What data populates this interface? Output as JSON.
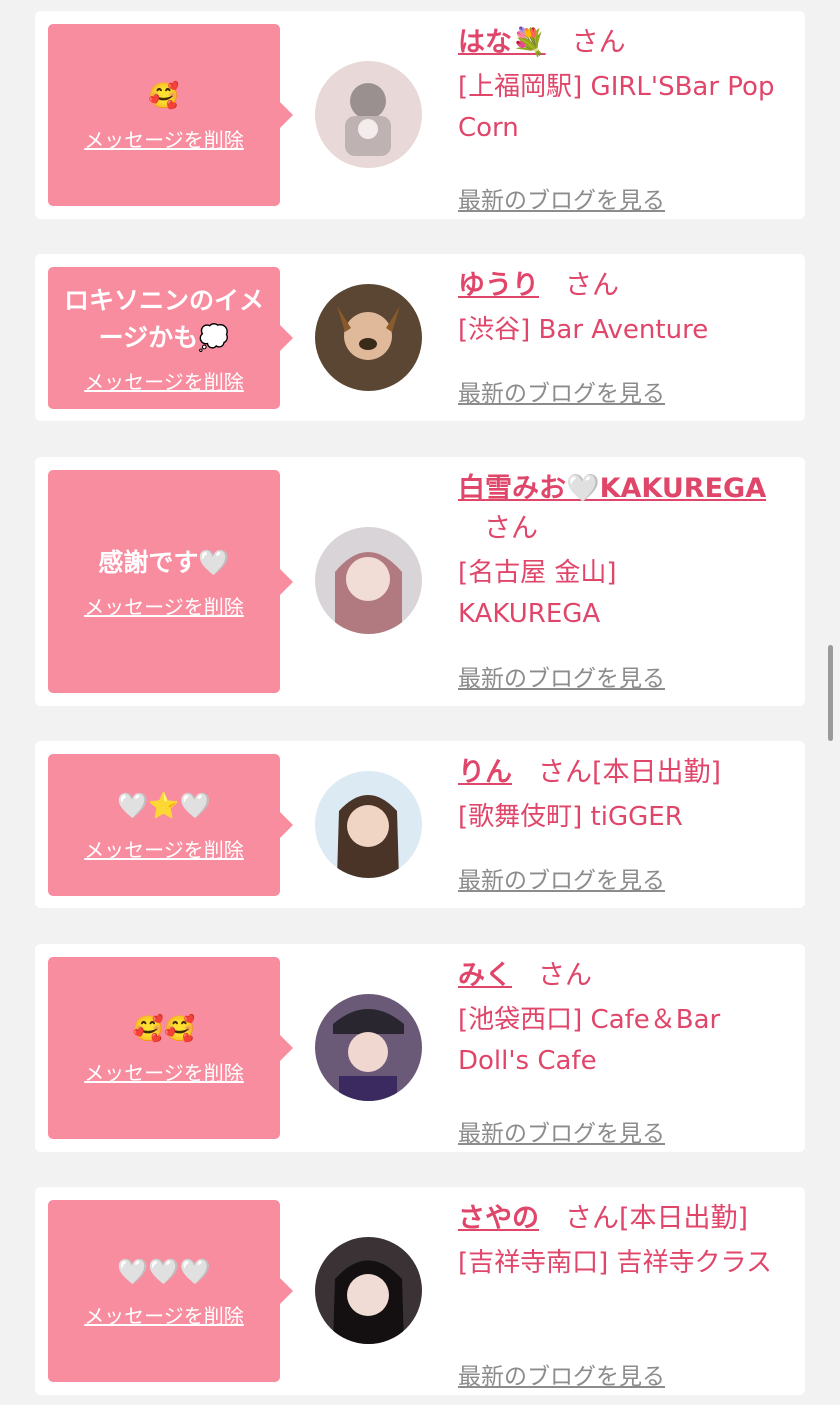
{
  "delete_label": "メッセージを削除",
  "blog_label": "最新のブログを見る",
  "san_label": "さん",
  "cards": [
    {
      "message": "🥰",
      "name": "はな💐",
      "san_suffix": "さん",
      "shop": "[上福岡駅] GIRL'SBar Pop Corn"
    },
    {
      "message": "ロキソニンのイメージかも💭",
      "name": "ゆうり",
      "san_suffix": "さん",
      "shop": "[渋谷] Bar Aventure"
    },
    {
      "message": "感謝です🤍",
      "name": "白雪みお🤍KAKUREGA",
      "san_suffix": "さん",
      "shop": "[名古屋 金山] KAKUREGA"
    },
    {
      "message": "🤍⭐🤍",
      "name": "りん",
      "san_suffix": "さん[本日出勤]",
      "shop": "[歌舞伎町] tiGGER"
    },
    {
      "message": "🥰🥰",
      "name": "みく",
      "san_suffix": "さん",
      "shop": "[池袋西口] Cafe＆Bar Doll's Cafe"
    },
    {
      "message": "🤍🤍🤍",
      "name": "さやの",
      "san_suffix": "さん[本日出勤]",
      "shop": "[吉祥寺南口] 吉祥寺クラス"
    }
  ]
}
